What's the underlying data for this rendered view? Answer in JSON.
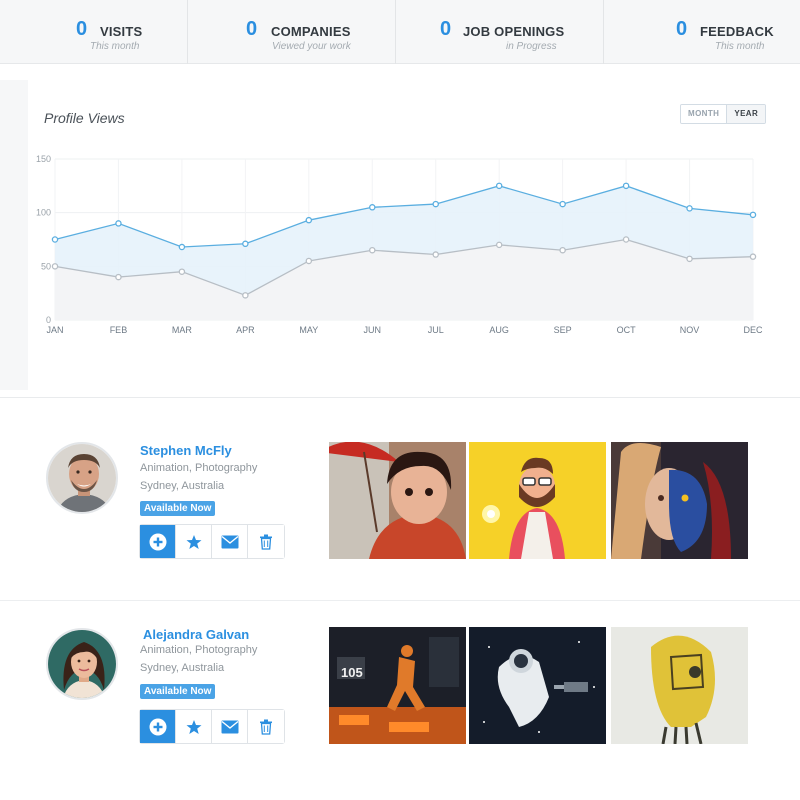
{
  "stats": [
    {
      "value": "0",
      "label": "VISITS",
      "sub": "This month"
    },
    {
      "value": "0",
      "label": "COMPANIES",
      "sub": "Viewed your work"
    },
    {
      "value": "0",
      "label": "JOB OPENINGS",
      "sub": "in Progress"
    },
    {
      "value": "0",
      "label": "FEEDBACK",
      "sub": "This month"
    }
  ],
  "chart_panel": {
    "title": "Profile Views",
    "toggle": {
      "month": "MONTH",
      "year": "YEAR",
      "selected": "YEAR"
    }
  },
  "chart_data": {
    "type": "area",
    "title": "Profile Views",
    "x": [
      "JAN",
      "FEB",
      "MAR",
      "APR",
      "MAY",
      "JUN",
      "JUL",
      "AUG",
      "SEP",
      "OCT",
      "NOV",
      "DEC"
    ],
    "y_ticks": [
      "0",
      "50",
      "100",
      "150"
    ],
    "ylim": [
      0,
      150
    ],
    "grid": true,
    "series": [
      {
        "values": [
          75,
          90,
          68,
          71,
          93,
          105,
          108,
          125,
          108,
          125,
          104,
          98
        ],
        "color": "#5aaee0"
      },
      {
        "values": [
          50,
          40,
          45,
          23,
          55,
          65,
          61,
          70,
          65,
          75,
          57,
          59
        ],
        "color": "#b7bec5"
      }
    ]
  },
  "profiles": [
    {
      "name": "Stephen McFly",
      "skills": "Animation, Photography",
      "location": "Sydney, Australia",
      "badge": "Available Now",
      "actions": [
        "plus-circle-icon",
        "star-icon",
        "envelope-icon",
        "trash-icon"
      ],
      "thumbnails": [
        "girl-with-umbrella-artwork",
        "cartoon-hipster-character-artwork",
        "blue-skinned-woman-artwork"
      ]
    },
    {
      "name": "Alejandra Galvan",
      "skills": "Animation, Photography",
      "location": "Sydney, Australia",
      "badge": "Available Now",
      "actions": [
        "plus-circle-icon",
        "star-icon",
        "envelope-icon",
        "trash-icon"
      ],
      "thumbnails": [
        "sci-fi-runner-artwork",
        "astronaut-in-space-artwork",
        "yellow-robot-head-artwork"
      ]
    }
  ],
  "colors": {
    "accent": "#2b8fe0",
    "badge": "#4aa3e6",
    "area_fill": "#e6f2fb"
  }
}
